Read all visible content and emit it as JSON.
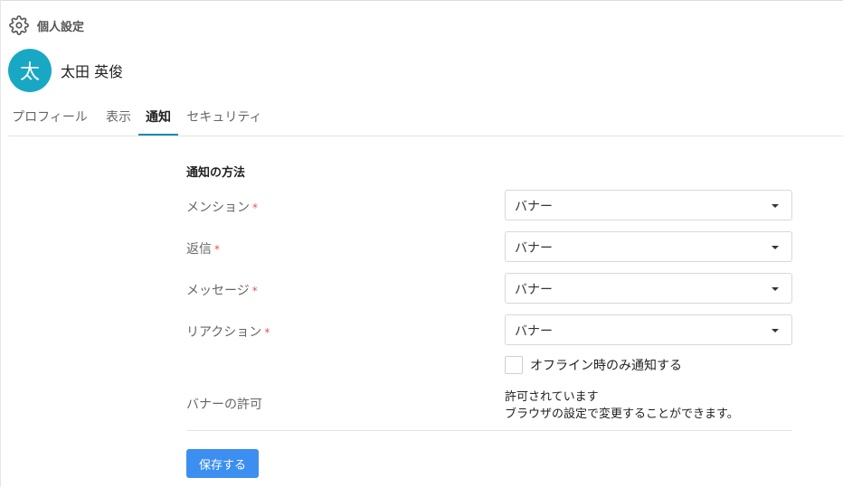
{
  "header": {
    "title": "個人設定",
    "icon": "gear-icon"
  },
  "user": {
    "avatar_char": "太",
    "name": "太田 英俊",
    "avatar_color": "#19a8c4"
  },
  "tabs": [
    {
      "label": "プロフィール"
    },
    {
      "label": "表示"
    },
    {
      "label": "通知",
      "active": true
    },
    {
      "label": "セキュリティ"
    }
  ],
  "notify": {
    "section_title": "通知の方法",
    "required_mark": "*",
    "rows": [
      {
        "label": "メンション",
        "value": "バナー"
      },
      {
        "label": "返信",
        "value": "バナー"
      },
      {
        "label": "メッセージ",
        "value": "バナー"
      },
      {
        "label": "リアクション",
        "value": "バナー"
      }
    ],
    "offline_checkbox_label": "オフライン時のみ通知する",
    "banner_permission_label": "バナーの許可",
    "banner_permission_status": "許可されています",
    "banner_permission_hint": "ブラウザの設定で変更することができます。"
  },
  "actions": {
    "save_label": "保存する",
    "save_color": "#3c8ff0"
  },
  "colors": {
    "accent": "#1a8bb5",
    "required": "#e05454"
  }
}
